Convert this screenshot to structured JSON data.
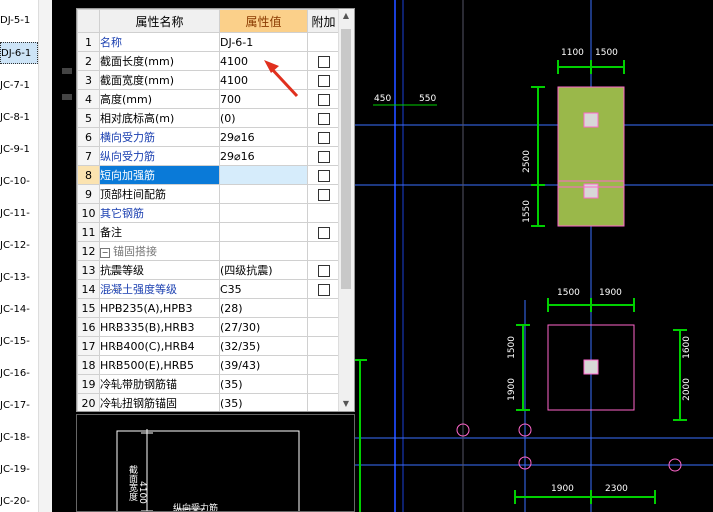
{
  "left_list": [
    "DJ-5-1",
    "DJ-6-1",
    "JC-7-1",
    "JC-8-1",
    "JC-9-1",
    "JC-10-",
    "JC-11-",
    "JC-12-",
    "JC-13-",
    "JC-14-",
    "JC-15-",
    "JC-16-",
    "JC-17-",
    "JC-18-",
    "JC-19-",
    "JC-20-"
  ],
  "selected_item": "DJ-6-1",
  "grid": {
    "headers": {
      "num": "",
      "name": "属性名称",
      "value": "属性值",
      "extra": "附加"
    },
    "rows": [
      {
        "num": "1",
        "name": "名称",
        "value": "DJ-6-1",
        "check": false
      },
      {
        "num": "2",
        "name": "截面长度(mm)",
        "value": "4100",
        "check": true
      },
      {
        "num": "3",
        "name": "截面宽度(mm)",
        "value": "4100",
        "check": true
      },
      {
        "num": "4",
        "name": "高度(mm)",
        "value": "700",
        "check": true
      },
      {
        "num": "5",
        "name": "相对底标高(m)",
        "value": "(0)",
        "check": true
      },
      {
        "num": "6",
        "name": "横向受力筋",
        "value": "29⌀16",
        "check": true
      },
      {
        "num": "7",
        "name": "纵向受力筋",
        "value": "29⌀16",
        "check": true
      },
      {
        "num": "8",
        "name": "短向加强筋",
        "value": "",
        "check": true
      },
      {
        "num": "9",
        "name": "顶部柱间配筋",
        "value": "",
        "check": true
      },
      {
        "num": "10",
        "name": "其它钢筋",
        "value": "",
        "check": false
      },
      {
        "num": "11",
        "name": "备注",
        "value": "",
        "check": true
      },
      {
        "num": "12",
        "name": "锚固搭接",
        "value": "",
        "check": false
      },
      {
        "num": "13",
        "name": "抗震等级",
        "value": "(四级抗震)",
        "check": true
      },
      {
        "num": "14",
        "name": "混凝土强度等级",
        "value": "C35",
        "check": true
      },
      {
        "num": "15",
        "name": "HPB235(A),HPB3",
        "value": "(28)",
        "check": false
      },
      {
        "num": "16",
        "name": "HRB335(B),HRB3",
        "value": "(27/30)",
        "check": false
      },
      {
        "num": "17",
        "name": "HRB400(C),HRB4",
        "value": "(32/35)",
        "check": false
      },
      {
        "num": "18",
        "name": "HRB500(E),HRB5",
        "value": "(39/43)",
        "check": false
      },
      {
        "num": "19",
        "name": "冷轧带肋钢筋锚",
        "value": "(35)",
        "check": false
      },
      {
        "num": "20",
        "name": "冷轧扭钢筋锚固",
        "value": "(35)",
        "check": false
      }
    ]
  },
  "cad": {
    "dims_top": [
      "1100",
      "1500"
    ],
    "dims_left": [
      "450",
      "550"
    ],
    "dims_side": [
      "2500",
      "1550"
    ],
    "dims_mid": [
      "1500",
      "1900"
    ],
    "dims_mid_side": [
      "1500",
      "1900"
    ],
    "dims_right": [
      "1600",
      "2000"
    ],
    "dims_bottom": [
      "1900",
      "2300"
    ]
  },
  "preview": {
    "dim": "4100",
    "label1": "截面宽度",
    "label2": "纵向受力筋"
  },
  "colors": {
    "selected_blue": "#0a7ad8",
    "header_orange": "#fbd08a",
    "footing_fill": "#9ab84a",
    "dim_green": "#00d000",
    "axis_blue": "#1a3fd8",
    "pink": "#ff66cc",
    "arrow_red": "#e0301e"
  }
}
